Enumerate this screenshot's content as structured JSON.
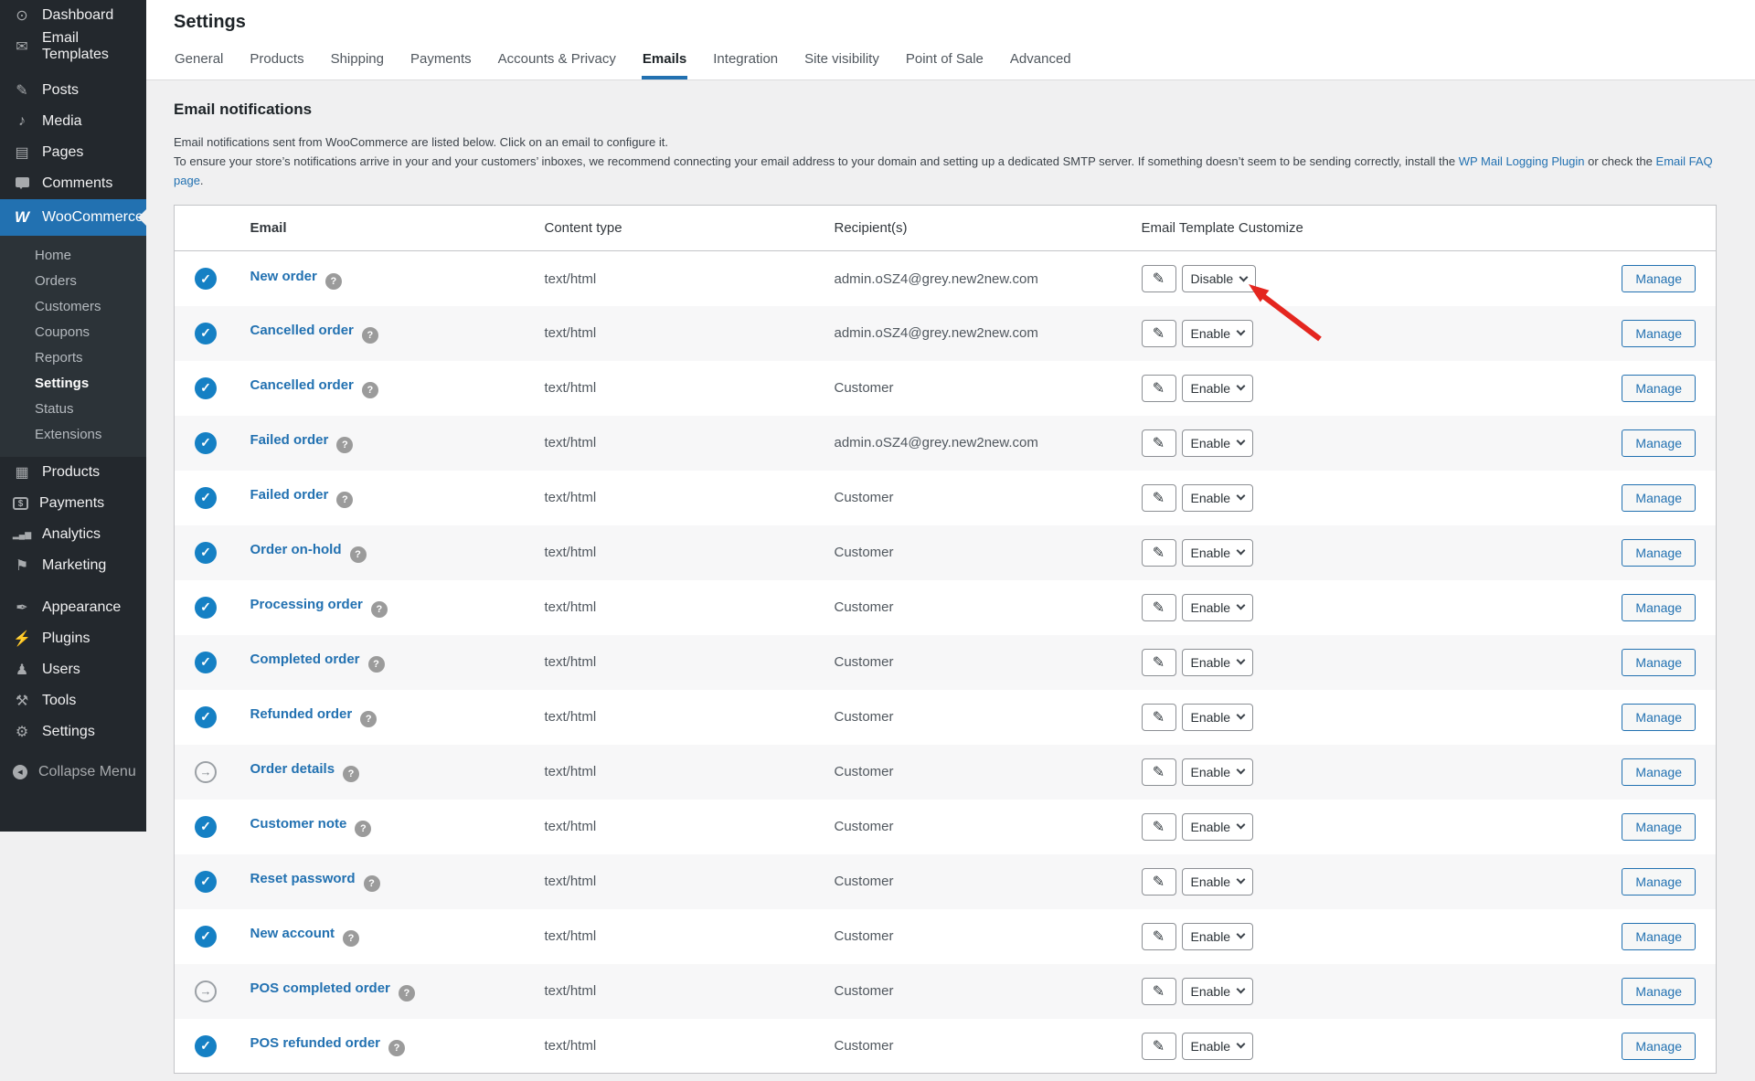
{
  "colors": {
    "accent": "#2271b1",
    "menu_bg": "#23282d",
    "check_icon": "#1580c4",
    "annotation_arrow": "#e4261f",
    "page_bg": "#f0f0f1"
  },
  "sidebar": {
    "top": [
      {
        "label": "Dashboard",
        "icon": "dashboard-icon",
        "glyph": "⊙"
      },
      {
        "label": "Email Templates",
        "icon": "email-templates-icon",
        "glyph": "✉"
      }
    ],
    "group2": [
      {
        "label": "Posts",
        "icon": "pushpin-icon",
        "glyph": "✎"
      },
      {
        "label": "Media",
        "icon": "media-icon",
        "glyph": "♪"
      },
      {
        "label": "Pages",
        "icon": "pages-icon",
        "glyph": "▤"
      },
      {
        "label": "Comments",
        "icon": "comments-icon",
        "glyph": ""
      }
    ],
    "woocommerce": {
      "label": "WooCommerce",
      "glyph": "W"
    },
    "submenu": [
      {
        "label": "Home"
      },
      {
        "label": "Orders"
      },
      {
        "label": "Customers"
      },
      {
        "label": "Coupons"
      },
      {
        "label": "Reports"
      },
      {
        "label": "Settings",
        "current": true
      },
      {
        "label": "Status"
      },
      {
        "label": "Extensions"
      }
    ],
    "group3": [
      {
        "label": "Products",
        "icon": "products-icon",
        "glyph": "▦"
      },
      {
        "label": "Payments",
        "icon": "payments-icon",
        "glyph": "$"
      },
      {
        "label": "Analytics",
        "icon": "analytics-icon",
        "glyph": "▂▄▆"
      },
      {
        "label": "Marketing",
        "icon": "marketing-icon",
        "glyph": "⚑"
      }
    ],
    "group4": [
      {
        "label": "Appearance",
        "icon": "appearance-icon",
        "glyph": "✒"
      },
      {
        "label": "Plugins",
        "icon": "plugins-icon",
        "glyph": "⚡"
      },
      {
        "label": "Users",
        "icon": "users-icon",
        "glyph": "♟"
      },
      {
        "label": "Tools",
        "icon": "tools-icon",
        "glyph": "⚒"
      },
      {
        "label": "Settings",
        "icon": "settings-icon",
        "glyph": "⚙"
      }
    ],
    "collapse": {
      "label": "Collapse Menu",
      "icon": "collapse-icon",
      "glyph": "◀"
    }
  },
  "header": {
    "title": "Settings",
    "tabs": [
      {
        "label": "General"
      },
      {
        "label": "Products"
      },
      {
        "label": "Shipping"
      },
      {
        "label": "Payments"
      },
      {
        "label": "Accounts & Privacy"
      },
      {
        "label": "Emails",
        "active": true
      },
      {
        "label": "Integration"
      },
      {
        "label": "Site visibility"
      },
      {
        "label": "Point of Sale"
      },
      {
        "label": "Advanced"
      }
    ]
  },
  "section": {
    "heading": "Email notifications",
    "description1": "Email notifications sent from WooCommerce are listed below. Click on an email to configure it.",
    "description2": {
      "text1": "To ensure your store’s notifications arrive in your and your customers’ inboxes, we recommend connecting your email address to your domain and setting up a dedicated SMTP server. If something doesn’t seem to be sending correctly, install the ",
      "link1": "WP Mail Logging Plugin",
      "text2": " or check the ",
      "link2": "Email FAQ page",
      "text3": "."
    }
  },
  "table": {
    "headers": {
      "email": "Email",
      "content_type": "Content type",
      "recipient": "Recipient(s)",
      "customize": "Email Template Customize"
    },
    "rows": [
      {
        "icon": "check",
        "name": "New order",
        "content_type": "text/html",
        "recipient": "admin.oSZ4@grey.new2new.com",
        "action": "Disable"
      },
      {
        "icon": "check",
        "name": "Cancelled order",
        "content_type": "text/html",
        "recipient": "admin.oSZ4@grey.new2new.com",
        "action": "Enable"
      },
      {
        "icon": "check",
        "name": "Cancelled order",
        "content_type": "text/html",
        "recipient": "Customer",
        "action": "Enable"
      },
      {
        "icon": "check",
        "name": "Failed order",
        "content_type": "text/html",
        "recipient": "admin.oSZ4@grey.new2new.com",
        "action": "Enable"
      },
      {
        "icon": "check",
        "name": "Failed order",
        "content_type": "text/html",
        "recipient": "Customer",
        "action": "Enable"
      },
      {
        "icon": "check",
        "name": "Order on-hold",
        "content_type": "text/html",
        "recipient": "Customer",
        "action": "Enable"
      },
      {
        "icon": "check",
        "name": "Processing order",
        "content_type": "text/html",
        "recipient": "Customer",
        "action": "Enable"
      },
      {
        "icon": "check",
        "name": "Completed order",
        "content_type": "text/html",
        "recipient": "Customer",
        "action": "Enable"
      },
      {
        "icon": "check",
        "name": "Refunded order",
        "content_type": "text/html",
        "recipient": "Customer",
        "action": "Enable"
      },
      {
        "icon": "arrow",
        "name": "Order details",
        "content_type": "text/html",
        "recipient": "Customer",
        "action": "Enable"
      },
      {
        "icon": "check",
        "name": "Customer note",
        "content_type": "text/html",
        "recipient": "Customer",
        "action": "Enable"
      },
      {
        "icon": "check",
        "name": "Reset password",
        "content_type": "text/html",
        "recipient": "Customer",
        "action": "Enable"
      },
      {
        "icon": "check",
        "name": "New account",
        "content_type": "text/html",
        "recipient": "Customer",
        "action": "Enable"
      },
      {
        "icon": "arrow",
        "name": "POS completed order",
        "content_type": "text/html",
        "recipient": "Customer",
        "action": "Enable"
      },
      {
        "icon": "check",
        "name": "POS refunded order",
        "content_type": "text/html",
        "recipient": "Customer",
        "action": "Enable"
      }
    ]
  },
  "glyphs": {
    "check": "✓",
    "arrow": "→",
    "help": "?",
    "pencil": "✎"
  },
  "labels": {
    "manage": "Manage"
  }
}
